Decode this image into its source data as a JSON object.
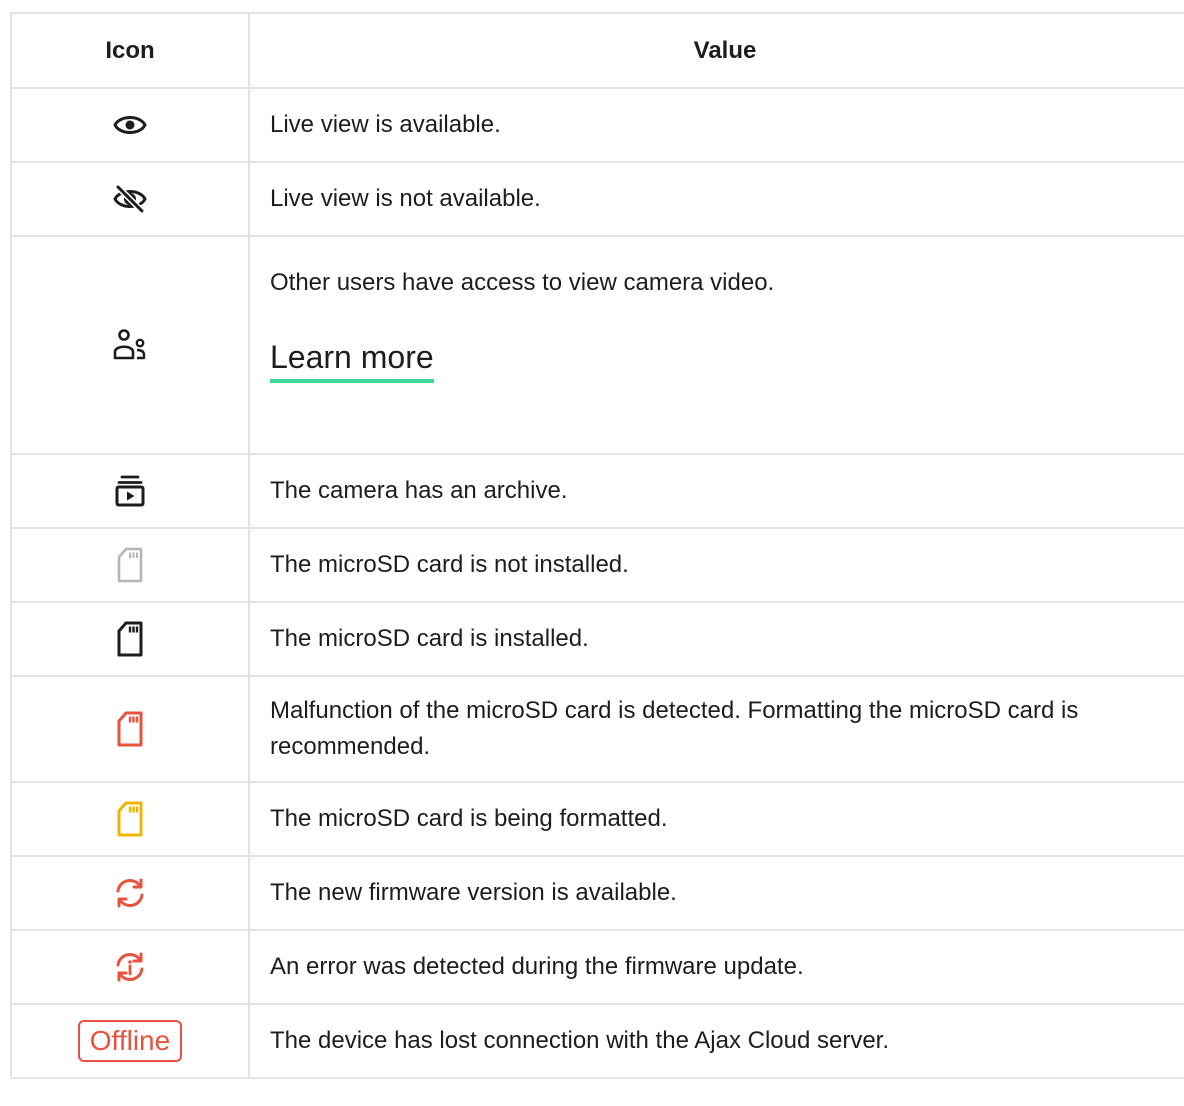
{
  "table": {
    "headers": {
      "icon": "Icon",
      "value": "Value"
    },
    "rows": [
      {
        "icon": "eye-icon",
        "value": "Live view is available."
      },
      {
        "icon": "eye-off-icon",
        "value": "Live view is not available."
      },
      {
        "icon": "shared-users-icon",
        "value": "Other users have access to view camera video.",
        "link": "Learn more"
      },
      {
        "icon": "archive-icon",
        "value": "The camera has an archive."
      },
      {
        "icon": "microsd-not-installed-icon",
        "value": "The microSD card is not installed."
      },
      {
        "icon": "microsd-installed-icon",
        "value": "The microSD card is installed."
      },
      {
        "icon": "microsd-malfunction-icon",
        "value": "Malfunction of the microSD card is detected. Formatting the microSD card is recommended."
      },
      {
        "icon": "microsd-formatting-icon",
        "value": "The microSD card is being formatted."
      },
      {
        "icon": "firmware-update-icon",
        "value": "The new firmware version is available."
      },
      {
        "icon": "firmware-error-icon",
        "value": "An error was detected during the firmware update."
      },
      {
        "icon": "offline-badge",
        "badge": "Offline",
        "value": "The device has lost connection with the Ajax Cloud server."
      }
    ]
  },
  "colors": {
    "border": "#e3e3e3",
    "text": "#1d1d1f",
    "link_underline": "#3fd79a",
    "icon_dark": "#1d1d1f",
    "icon_grey": "#b5b5b5",
    "icon_red": "#e8533f",
    "icon_yellow": "#f0b400"
  }
}
